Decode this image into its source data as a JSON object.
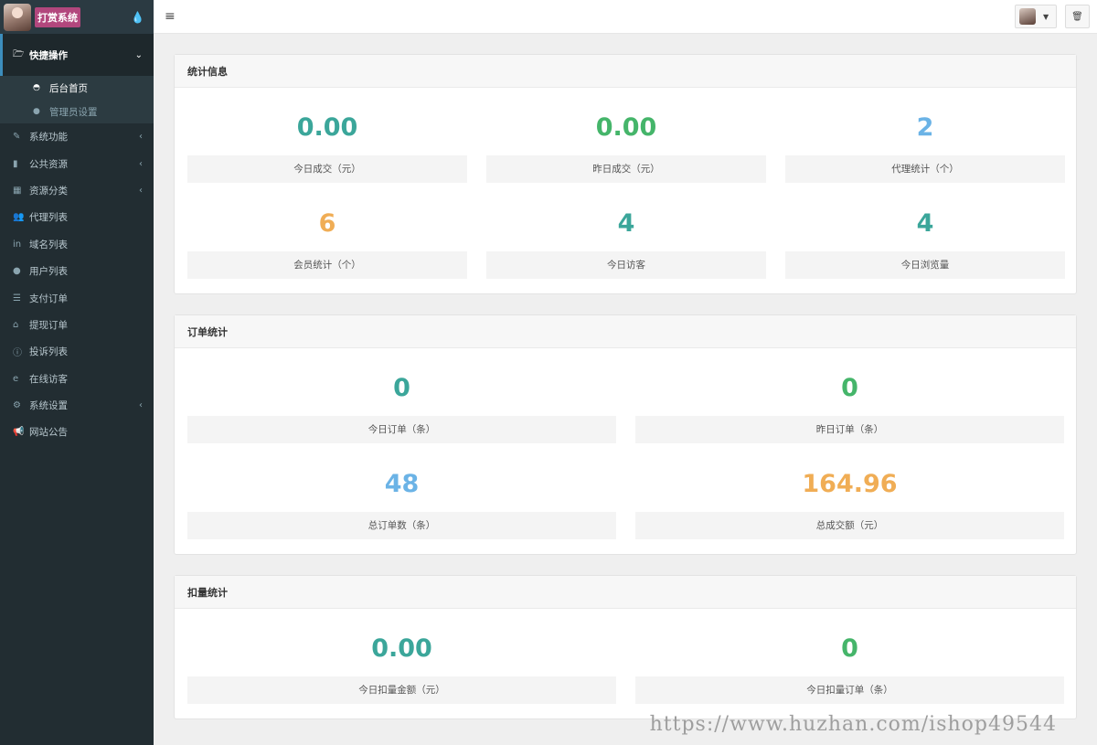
{
  "brand": {
    "title": "打赏系统",
    "drop_icon": "droplet-icon"
  },
  "sidebar": {
    "open_group": {
      "label": "快捷操作",
      "icon": "folder-open-icon"
    },
    "sub_items": [
      {
        "label": "后台首页",
        "icon": "dashboard-icon"
      },
      {
        "label": "管理员设置",
        "icon": "user-icon"
      }
    ],
    "items": [
      {
        "label": "系统功能",
        "icon": "wrench-icon",
        "caret": true
      },
      {
        "label": "公共资源",
        "icon": "video-icon",
        "caret": true
      },
      {
        "label": "资源分类",
        "icon": "th-icon",
        "caret": true
      },
      {
        "label": "代理列表",
        "icon": "users-icon",
        "caret": false
      },
      {
        "label": "域名列表",
        "icon": "linkedin-icon",
        "caret": false
      },
      {
        "label": "用户列表",
        "icon": "user-icon",
        "caret": false
      },
      {
        "label": "支付订单",
        "icon": "database-icon",
        "caret": false
      },
      {
        "label": "提现订单",
        "icon": "bank-icon",
        "caret": false
      },
      {
        "label": "投诉列表",
        "icon": "info-icon",
        "caret": false
      },
      {
        "label": "在线访客",
        "icon": "ie-icon",
        "caret": false
      },
      {
        "label": "系统设置",
        "icon": "gear-icon",
        "caret": true
      },
      {
        "label": "网站公告",
        "icon": "bullhorn-icon",
        "caret": false
      }
    ]
  },
  "topbar": {
    "menu_icon": "hamburger-icon",
    "trash_icon": "trash-icon"
  },
  "panels": {
    "stats": {
      "title": "统计信息",
      "items": [
        {
          "value": "0.00",
          "caption": "今日成交（元）",
          "color": "#3ba69a"
        },
        {
          "value": "0.00",
          "caption": "昨日成交（元）",
          "color": "#45b56a"
        },
        {
          "value": "2",
          "caption": "代理统计（个）",
          "color": "#6bb3e6"
        },
        {
          "value": "6",
          "caption": "会员统计（个）",
          "color": "#f0ad55"
        },
        {
          "value": "4",
          "caption": "今日访客",
          "color": "#3ba69a"
        },
        {
          "value": "4",
          "caption": "今日浏览量",
          "color": "#3ba69a"
        }
      ]
    },
    "orders": {
      "title": "订单统计",
      "items": [
        {
          "value": "0",
          "caption": "今日订单（条）",
          "color": "#3ba69a"
        },
        {
          "value": "0",
          "caption": "昨日订单（条）",
          "color": "#45b56a"
        },
        {
          "value": "48",
          "caption": "总订单数（条）",
          "color": "#6bb3e6"
        },
        {
          "value": "164.96",
          "caption": "总成交额（元）",
          "color": "#f0ad55"
        }
      ]
    },
    "deduct": {
      "title": "扣量统计",
      "items": [
        {
          "value": "0.00",
          "caption": "今日扣量金额（元）",
          "color": "#3ba69a"
        },
        {
          "value": "0",
          "caption": "今日扣量订单（条）",
          "color": "#45b56a"
        }
      ]
    }
  },
  "watermark": "https://www.huzhan.com/ishop49544"
}
